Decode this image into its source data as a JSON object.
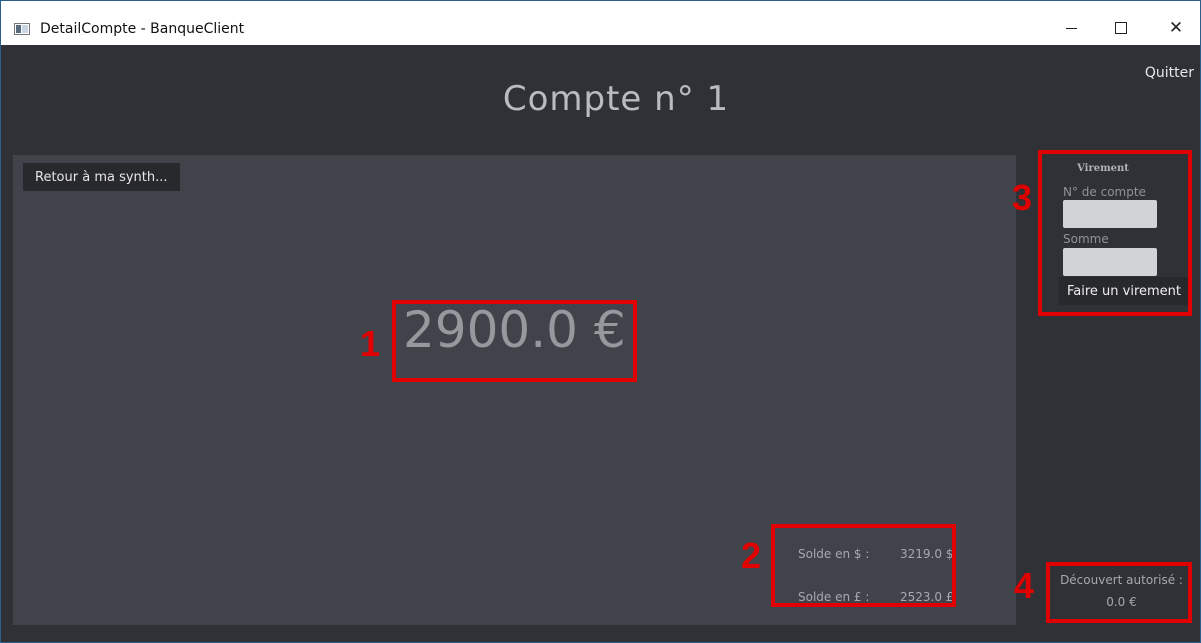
{
  "window": {
    "title": "DetailCompte - BanqueClient",
    "controls": {
      "minimize": "minimize",
      "maximize": "maximize",
      "close": "✕"
    }
  },
  "header": {
    "title": "Compte n° 1",
    "quit_label": "Quitter"
  },
  "main": {
    "back_label": "Retour à ma synth...",
    "balance": "2900.0 €",
    "other_currencies": [
      {
        "label": "Solde en $ :",
        "value": "3219.0 $"
      },
      {
        "label": "Solde en £ :",
        "value": "2523.0 £"
      }
    ]
  },
  "transfer": {
    "title": "Virement",
    "account_label": "N° de compte",
    "account_value": "",
    "amount_label": "Somme",
    "amount_value": "",
    "submit_label": "Faire un virement"
  },
  "overdraft": {
    "label": "Découvert autorisé :",
    "value": "0.0 €"
  },
  "annotations": [
    {
      "number": "1"
    },
    {
      "number": "2"
    },
    {
      "number": "3"
    },
    {
      "number": "4"
    }
  ],
  "colors": {
    "background": "#2f3136",
    "panel": "#41434b",
    "button": "#28292d",
    "annotation": "#e00000"
  },
  "icons": [
    "app-window-icon",
    "minimize-icon",
    "maximize-icon",
    "close-icon"
  ]
}
